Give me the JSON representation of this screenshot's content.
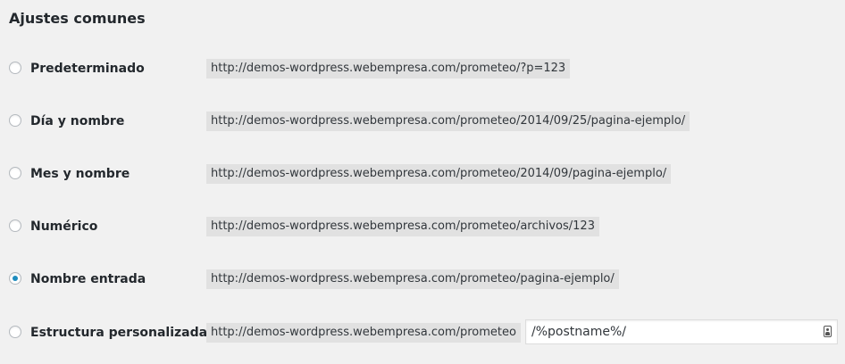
{
  "section": {
    "title": "Ajustes comunes"
  },
  "options": [
    {
      "label": "Predeterminado",
      "example": "http://demos-wordpress.webempresa.com/prometeo/?p=123",
      "checked": false
    },
    {
      "label": "Día y nombre",
      "example": "http://demos-wordpress.webempresa.com/prometeo/2014/09/25/pagina-ejemplo/",
      "checked": false
    },
    {
      "label": "Mes y nombre",
      "example": "http://demos-wordpress.webempresa.com/prometeo/2014/09/pagina-ejemplo/",
      "checked": false
    },
    {
      "label": "Numérico",
      "example": "http://demos-wordpress.webempresa.com/prometeo/archivos/123",
      "checked": false
    },
    {
      "label": "Nombre entrada",
      "example": "http://demos-wordpress.webempresa.com/prometeo/pagina-ejemplo/",
      "checked": true
    },
    {
      "label": "Estructura personalizada",
      "example": "http://demos-wordpress.webempresa.com/prometeo",
      "checked": false,
      "input_value": "/%postname%/",
      "input_icon": "contact-card-icon"
    }
  ],
  "colors": {
    "background": "#f1f1f1",
    "code_background": "#e1e1e1",
    "radio_checked": "#1e8cbe",
    "text": "#23282d"
  }
}
